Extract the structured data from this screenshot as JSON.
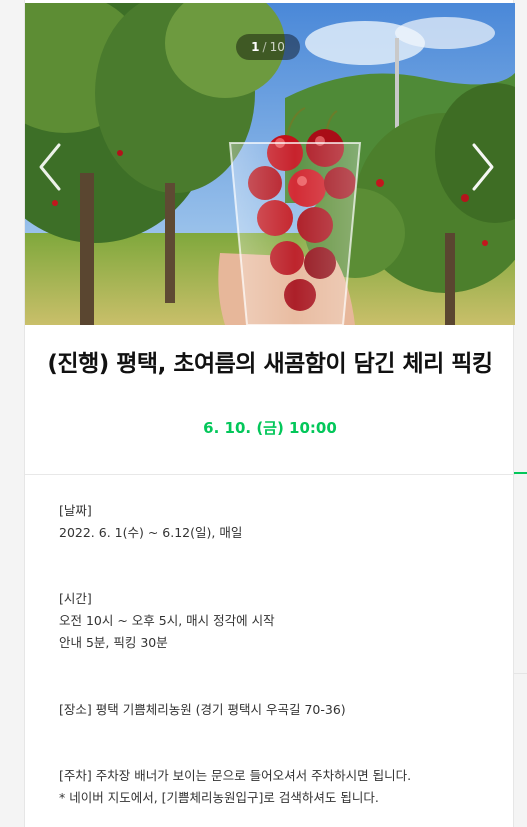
{
  "gallery": {
    "current": "1",
    "separator": "/",
    "total": "10"
  },
  "event": {
    "title": "(진행) 평택, 초여름의 새콤함이 담긴 체리 픽킹",
    "date": "6. 10. (금) 10:00"
  },
  "details": {
    "date_heading": "[날짜]",
    "date_value": "2022. 6. 1(수) ~ 6.12(일), 매일",
    "time_heading": "[시간]",
    "time_line1": "오전 10시 ~ 오후 5시, 매시 정각에 시작",
    "time_line2": "안내 5분, 픽킹 30분",
    "place_line": "[장소] 평택 기쁨체리농원 (경기 평택시 우곡길 70-36)",
    "parking_line1": "[주차] 주차장 배너가 보이는 문으로 들어오셔서 주차하시면 됩니다.",
    "parking_line2": "* 네이버 지도에서, [기쁨체리농원입구]로 검색하셔도 됩니다."
  },
  "colors": {
    "accent": "#03c75a"
  },
  "icons": {
    "prev": "chevron-left-icon",
    "next": "chevron-right-icon"
  }
}
